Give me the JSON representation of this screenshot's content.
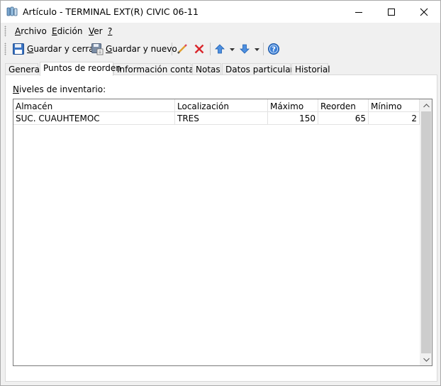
{
  "window": {
    "title": "Artículo - TERMINAL EXT(R) CIVIC 06-11",
    "controls": {
      "minimize": "minimize-icon",
      "maximize": "maximize-icon",
      "close": "close-icon"
    }
  },
  "menu": {
    "items": [
      {
        "label": "Archivo",
        "accel": "A",
        "rest": "rchivo"
      },
      {
        "label": "Edición",
        "accel": "E",
        "rest": "dición"
      },
      {
        "label": "Ver",
        "accel": "V",
        "rest": "er"
      },
      {
        "label": "?",
        "accel": "?",
        "rest": ""
      }
    ]
  },
  "toolbar": {
    "save_close": {
      "accel": "G",
      "rest": "uardar y cerrar",
      "label": "Guardar y cerrar",
      "icon": "floppy-disk-icon"
    },
    "save_new": {
      "accel": "G",
      "rest": "uardar y nuevo",
      "label": "Guardar y nuevo",
      "icon": "floppy-new-icon"
    },
    "edit_icon": "pencil-icon",
    "delete_icon": "delete-x-icon",
    "up_icon": "arrow-up-icon",
    "down_icon": "arrow-down-icon",
    "help_icon": "help-icon"
  },
  "tabs": [
    {
      "label": "General",
      "active": false
    },
    {
      "label": "Puntos de reorden",
      "active": true
    },
    {
      "label": "Información contable",
      "active": false
    },
    {
      "label": "Notas",
      "active": false
    },
    {
      "label": "Datos particulares",
      "active": false
    },
    {
      "label": "Historial",
      "active": false
    }
  ],
  "panel": {
    "label_accel": "N",
    "label_rest": "iveles de inventario:",
    "label": "Niveles de inventario:"
  },
  "grid": {
    "columns": [
      "Almacén",
      "Localización",
      "Máximo",
      "Reorden",
      "Mínimo"
    ],
    "rows": [
      {
        "almacen": "SUC. CUAUHTEMOC",
        "localizacion": "TRES",
        "maximo": "150",
        "reorden": "65",
        "minimo": "2"
      }
    ]
  },
  "colors": {
    "accent_blue": "#1e73d2",
    "delete_red": "#d9262b",
    "scroll_thumb": "#cdcdcd"
  }
}
